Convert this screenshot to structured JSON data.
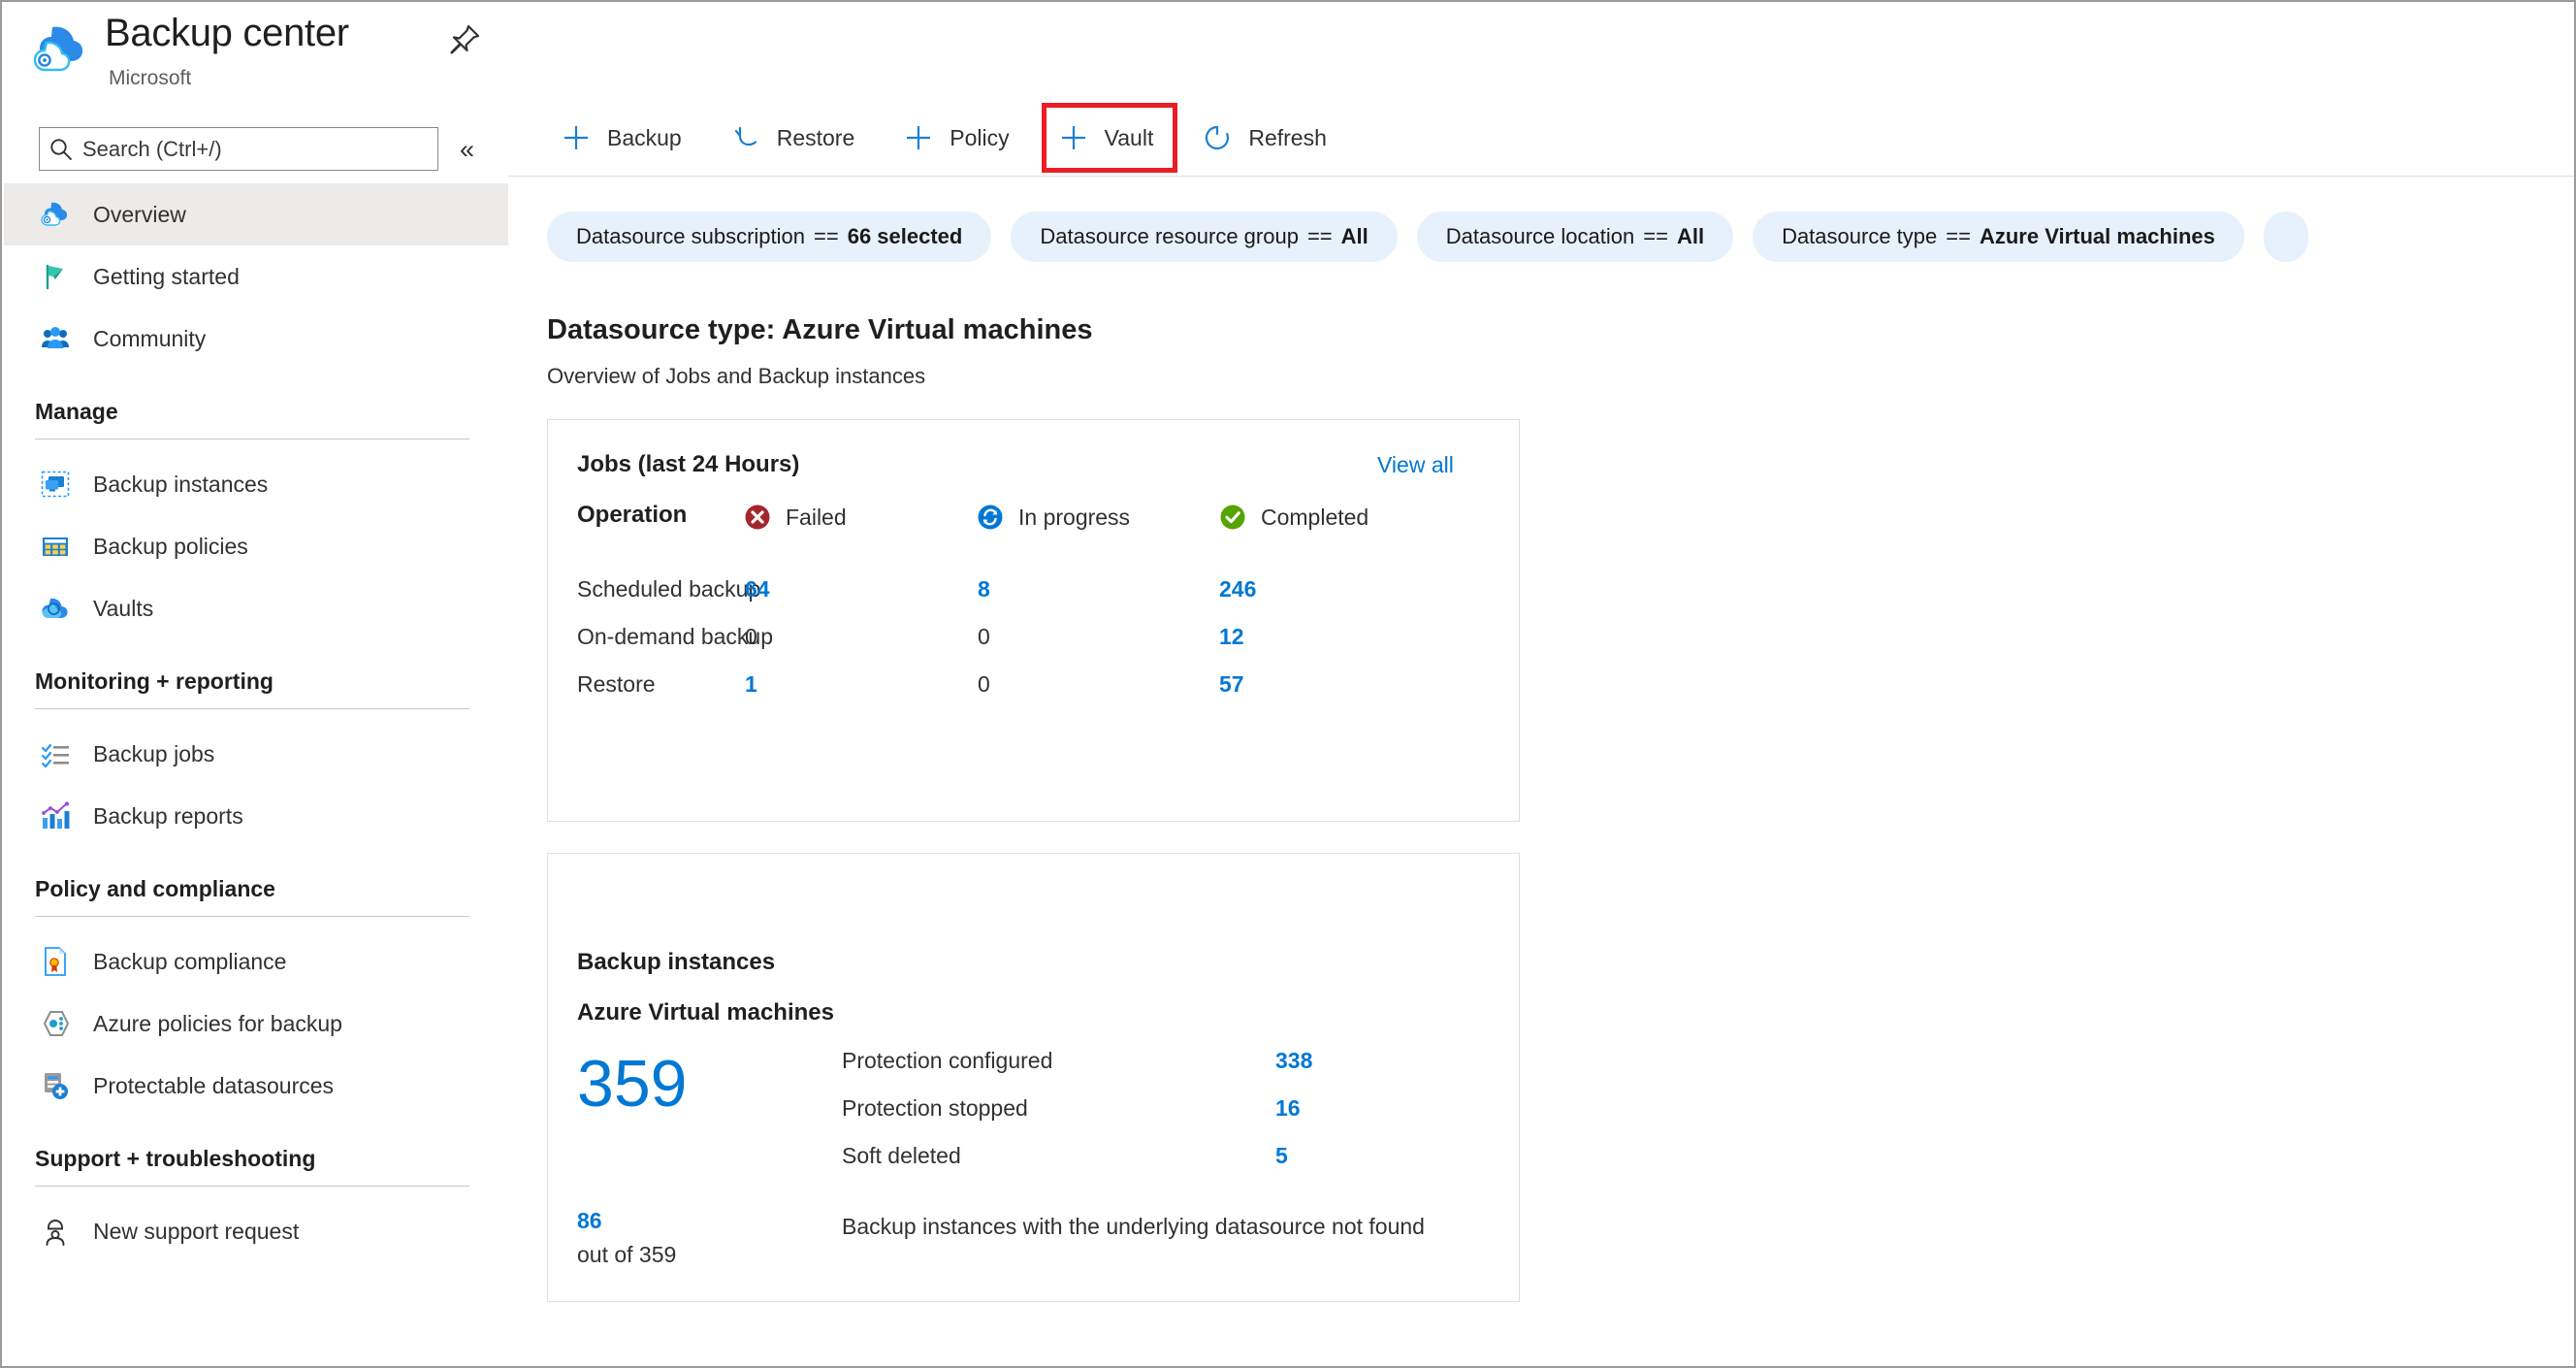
{
  "brand": {
    "title": "Backup center",
    "subtitle": "Microsoft",
    "pin_icon": "pin-icon",
    "more_icon": "ellipsis-icon"
  },
  "search": {
    "placeholder": "Search (Ctrl+/)",
    "value": "",
    "icon": "search-icon",
    "collapse_icon": "chevron-double-left-icon"
  },
  "sidebar": {
    "top_items": [
      {
        "label": "Overview",
        "icon": "backup-center-cloud-icon",
        "active": true
      },
      {
        "label": "Getting started",
        "icon": "flag-icon",
        "active": false
      },
      {
        "label": "Community",
        "icon": "people-icon",
        "active": false
      }
    ],
    "groups": [
      {
        "title": "Manage",
        "items": [
          {
            "label": "Backup instances",
            "icon": "backup-instance-icon"
          },
          {
            "label": "Backup policies",
            "icon": "policy-grid-icon"
          },
          {
            "label": "Vaults",
            "icon": "vault-cloud-icon"
          }
        ]
      },
      {
        "title": "Monitoring + reporting",
        "items": [
          {
            "label": "Backup jobs",
            "icon": "checklist-icon"
          },
          {
            "label": "Backup reports",
            "icon": "bar-chart-icon"
          }
        ]
      },
      {
        "title": "Policy and compliance",
        "items": [
          {
            "label": "Backup compliance",
            "icon": "compliance-document-icon"
          },
          {
            "label": "Azure policies for backup",
            "icon": "azure-policy-hexagon-icon"
          },
          {
            "label": "Protectable datasources",
            "icon": "protectable-datasource-icon"
          }
        ]
      },
      {
        "title": "Support + troubleshooting",
        "items": [
          {
            "label": "New support request",
            "icon": "support-person-icon"
          }
        ]
      }
    ]
  },
  "toolbar": {
    "buttons": [
      {
        "label": "Backup",
        "icon": "plus-icon",
        "highlighted": false
      },
      {
        "label": "Restore",
        "icon": "restore-undo-icon",
        "highlighted": false
      },
      {
        "label": "Policy",
        "icon": "plus-icon",
        "highlighted": false
      },
      {
        "label": "Vault",
        "icon": "plus-icon",
        "highlighted": true
      },
      {
        "label": "Refresh",
        "icon": "refresh-icon",
        "highlighted": false
      }
    ],
    "highlight_color": "#ec1c24"
  },
  "filters": [
    {
      "field": "Datasource subscription",
      "op": "==",
      "value": "66 selected"
    },
    {
      "field": "Datasource resource group",
      "op": "==",
      "value": "All"
    },
    {
      "field": "Datasource location",
      "op": "==",
      "value": "All"
    },
    {
      "field": "Datasource type",
      "op": "==",
      "value": "Azure Virtual machines"
    }
  ],
  "content": {
    "title": "Datasource type: Azure Virtual machines",
    "subtitle": "Overview of Jobs and Backup instances"
  },
  "jobs_card": {
    "title": "Jobs (last 24 Hours)",
    "view_all": "View all",
    "operation_header": "Operation",
    "status_columns": [
      {
        "label": "Failed",
        "icon": "failed-x-icon",
        "color": "#a4262c"
      },
      {
        "label": "In progress",
        "icon": "in-progress-sync-icon",
        "color": "#0078d4"
      },
      {
        "label": "Completed",
        "icon": "completed-check-icon",
        "color": "#57a300"
      }
    ],
    "rows": [
      {
        "operation": "Scheduled backup",
        "failed": "64",
        "in_progress": "8",
        "completed": "246"
      },
      {
        "operation": "On-demand backup",
        "failed": "0",
        "in_progress": "0",
        "completed": "12"
      },
      {
        "operation": "Restore",
        "failed": "1",
        "in_progress": "0",
        "completed": "57"
      }
    ]
  },
  "instances_card": {
    "title": "Backup instances",
    "subtitle": "Azure Virtual machines",
    "total": "359",
    "breakdown": [
      {
        "label": "Protection configured",
        "value": "338"
      },
      {
        "label": "Protection stopped",
        "value": "16"
      },
      {
        "label": "Soft deleted",
        "value": "5"
      }
    ],
    "not_found_count": "86",
    "not_found_outof": "out of 359",
    "not_found_text": "Backup instances with the underlying datasource not found"
  },
  "colors": {
    "accent": "#0078d4",
    "chip_bg": "#e6f1fb",
    "active_nav_bg": "#edebe9",
    "border": "#e1dfdd",
    "text": "#323130"
  }
}
